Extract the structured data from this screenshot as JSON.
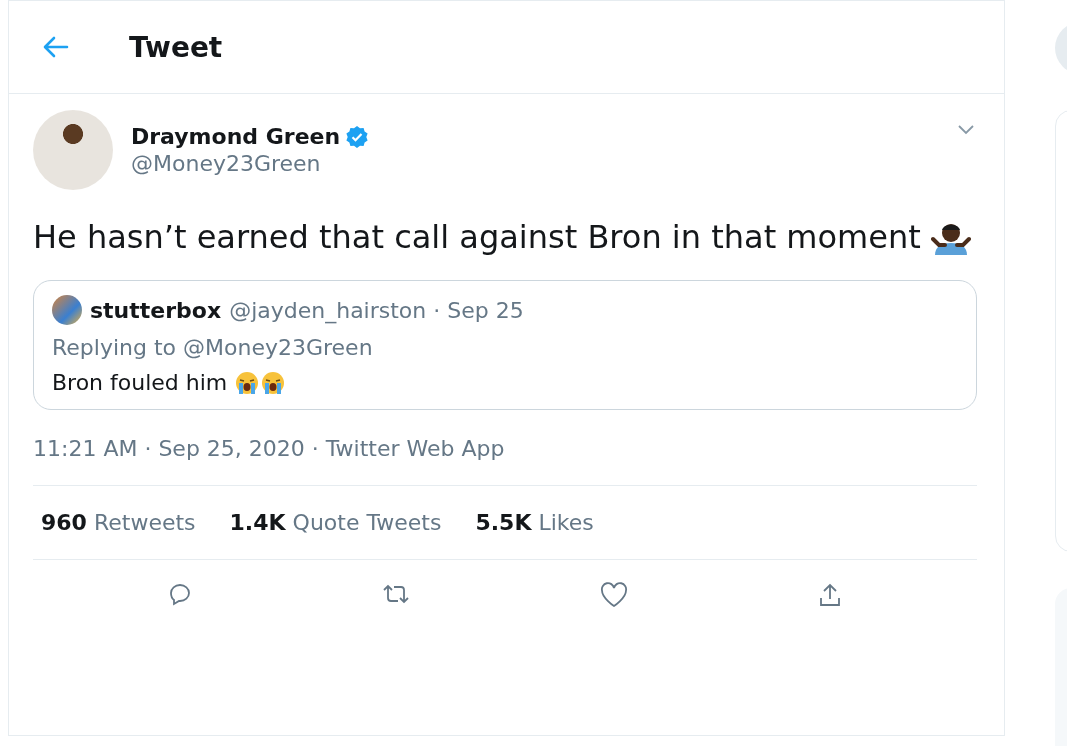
{
  "header": {
    "title": "Tweet"
  },
  "tweet": {
    "author": {
      "name": "Draymond Green",
      "handle": "@Money23Green",
      "verified": true
    },
    "text": "He hasn’t earned that call against Bron in that moment",
    "quoted": {
      "name": "stutterbox",
      "handle": "@jayden_hairston · Sep 25",
      "replying_to": "Replying to @Money23Green",
      "text": "Bron fouled him"
    },
    "timestamp": "11:21 AM · Sep 25, 2020 · Twitter Web App",
    "stats": [
      {
        "count": "960",
        "label": "Retweets"
      },
      {
        "count": "1.4K",
        "label": "Quote Tweets"
      },
      {
        "count": "5.5K",
        "label": "Likes"
      }
    ]
  }
}
